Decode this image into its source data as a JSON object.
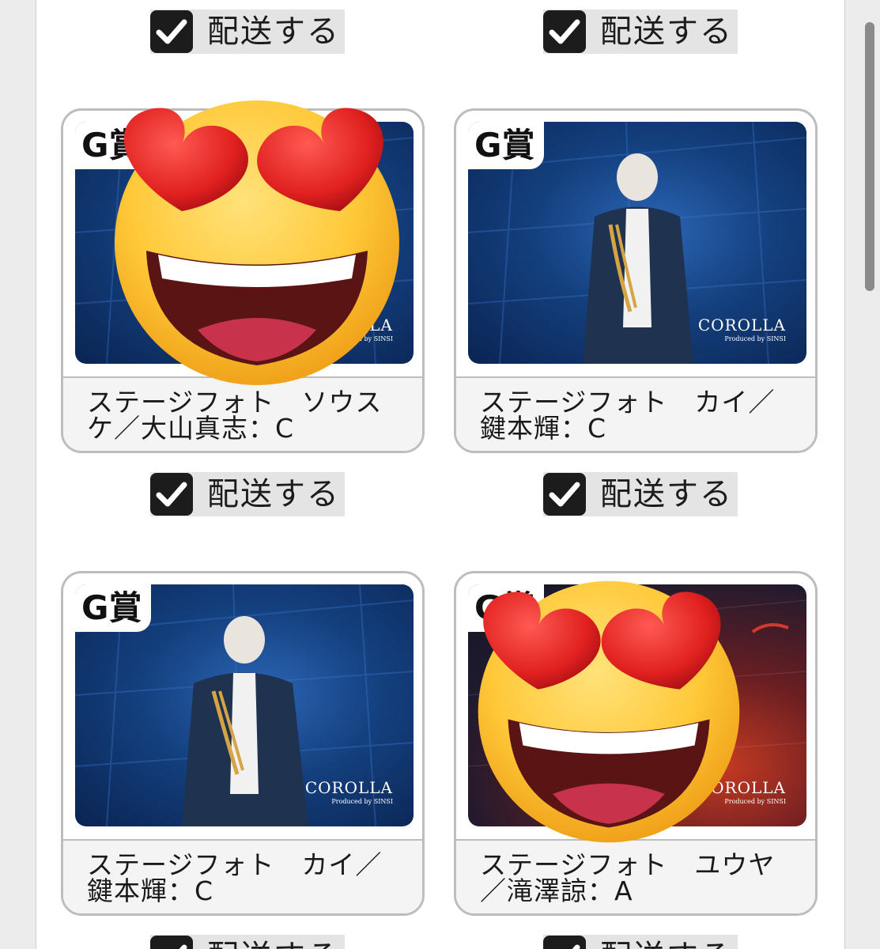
{
  "deliver_label": "配送する",
  "scrollbar": {
    "label": "scrollbar"
  },
  "cards": [
    {
      "prize": "G賞",
      "title": "ステージフォト　ソウスケ／大山真志：C",
      "brand": "COROLLA",
      "brand_sub": "Produced by SINSI",
      "photo_theme": "blue",
      "covered_by_emoji": true
    },
    {
      "prize": "G賞",
      "title": "ステージフォト　カイ／鍵本輝：C",
      "brand": "COROLLA",
      "brand_sub": "Produced by SINSI",
      "photo_theme": "blue",
      "covered_by_emoji": false
    },
    {
      "prize": "G賞",
      "title": "ステージフォト　カイ／鍵本輝：C",
      "brand": "COROLLA",
      "brand_sub": "Produced by SINSI",
      "photo_theme": "blue",
      "covered_by_emoji": false
    },
    {
      "prize": "G賞",
      "title": "ステージフォト　ユウヤ／滝澤諒：A",
      "brand": "COROLLA",
      "brand_sub": "Produced by SINSI",
      "photo_theme": "red",
      "covered_by_emoji": true
    }
  ],
  "colors": {
    "checkbox": "#1c1c1c",
    "card_border": "#bdbdbd",
    "emoji_face": "#ffc93a",
    "emoji_heart": "#e8262c"
  },
  "icons": {
    "checkbox": "checkmark-icon",
    "overlay": "heart-eyes-emoji"
  }
}
